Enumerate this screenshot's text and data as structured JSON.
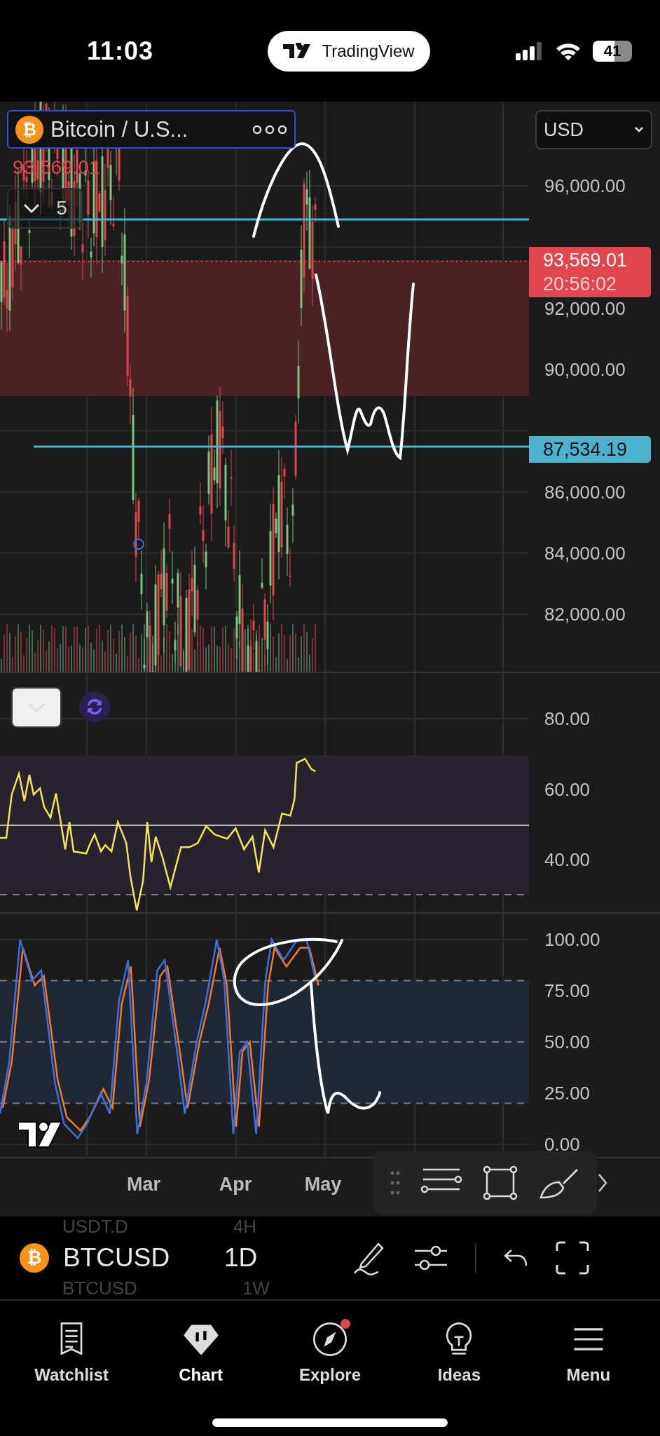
{
  "status_bar": {
    "time": "11:03",
    "app_pill": "TradingView",
    "battery": "41"
  },
  "legend": {
    "coin_glyph": "₿",
    "symbol": "Bitcoin / U.S...",
    "price": "93,569.01",
    "indicator_count": "5"
  },
  "currency_select": {
    "value": "USD"
  },
  "price_axis": {
    "ticks": [
      "96,000.00",
      "92,000.00",
      "90,000.00",
      "86,000.00",
      "84,000.00",
      "82,000.00"
    ],
    "last_price": "93,569.01",
    "countdown": "20:56:02",
    "line_price": "87,534.19"
  },
  "rsi_axis": {
    "ticks": [
      "80.00",
      "60.00",
      "40.00"
    ]
  },
  "stoch_axis": {
    "ticks": [
      "100.00",
      "75.00",
      "50.00",
      "25.00",
      "0.00"
    ]
  },
  "time_axis": {
    "labels": [
      "Mar",
      "Apr",
      "May"
    ]
  },
  "symbol_bar": {
    "coin_glyph": "₿",
    "symbol": "BTCUSD",
    "interval": "1D",
    "picker_above": {
      "symbol": "USDT.D",
      "interval": "4H"
    },
    "picker_below": {
      "symbol": "BTCUSD",
      "interval": "1W"
    }
  },
  "tab_bar": {
    "items": [
      {
        "label": "Watchlist",
        "kind": "watchlist",
        "selected": false,
        "badge": false
      },
      {
        "label": "Chart",
        "kind": "chart",
        "selected": true,
        "badge": false
      },
      {
        "label": "Explore",
        "kind": "explore",
        "selected": false,
        "badge": true
      },
      {
        "label": "Ideas",
        "kind": "ideas",
        "selected": false,
        "badge": false
      },
      {
        "label": "Menu",
        "kind": "menu",
        "selected": false,
        "badge": false
      }
    ]
  }
}
